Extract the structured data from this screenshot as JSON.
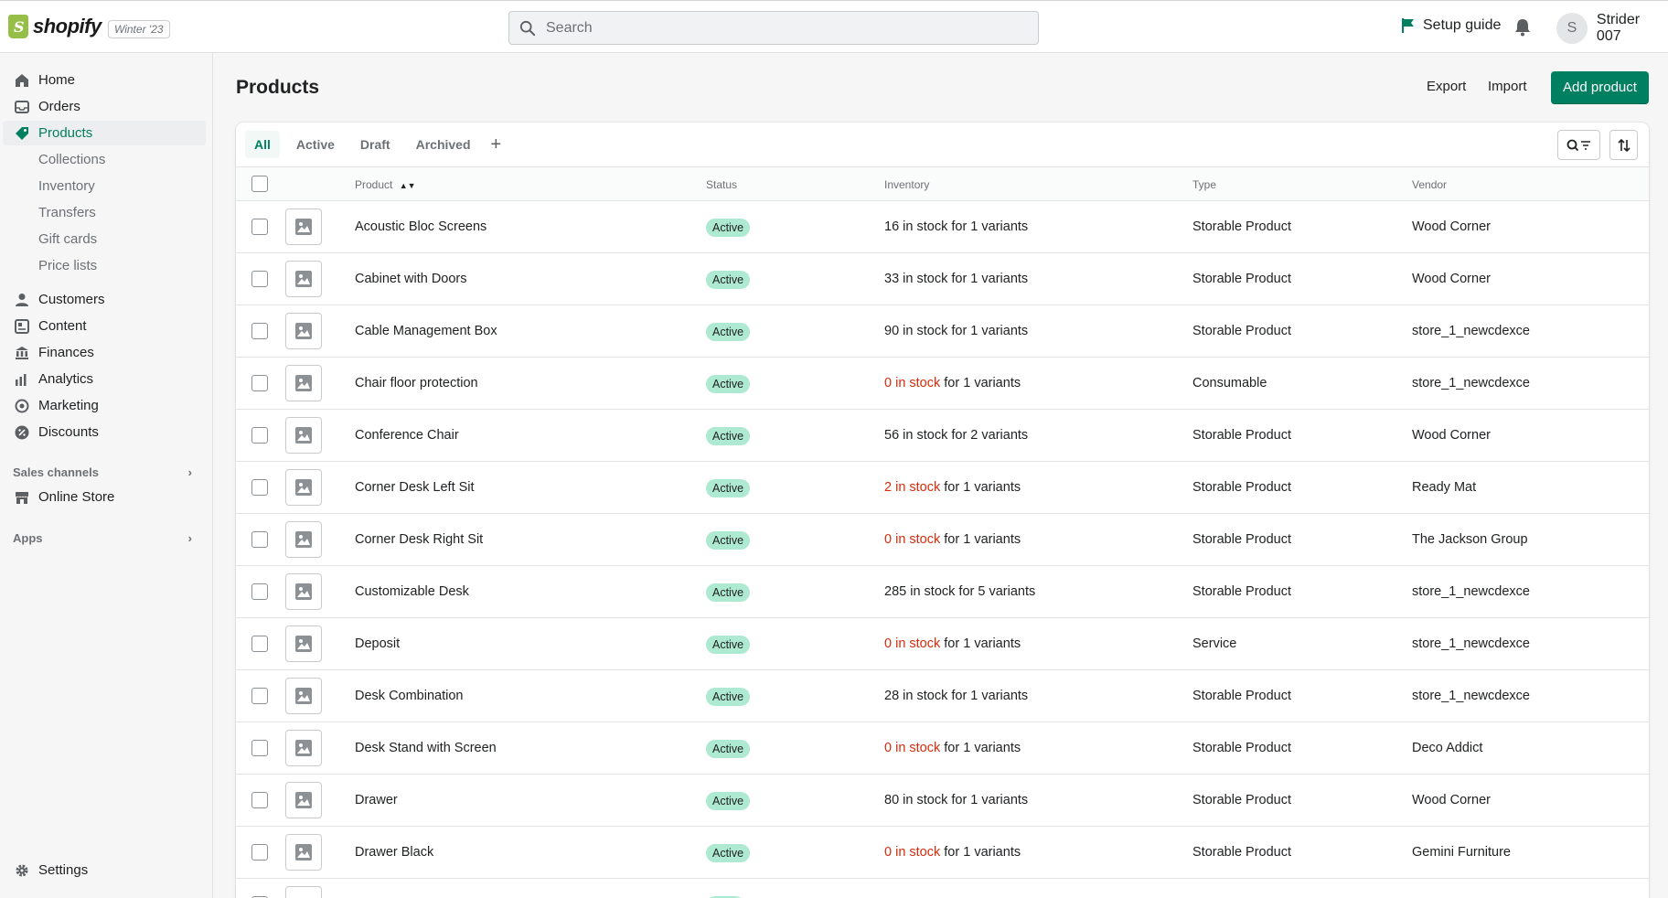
{
  "topbar": {
    "brand": "shopify",
    "version": "Winter '23",
    "search_placeholder": "Search",
    "setup_guide": "Setup guide",
    "user_initial": "S",
    "user_name": "Strider 007"
  },
  "sidebar": {
    "main_items": [
      "Home",
      "Orders",
      "Products"
    ],
    "product_sub_items": [
      "Collections",
      "Inventory",
      "Transfers",
      "Gift cards",
      "Price lists"
    ],
    "other_items": [
      "Customers",
      "Content",
      "Finances",
      "Analytics",
      "Marketing",
      "Discounts"
    ],
    "sales_channels_title": "Sales channels",
    "sales_channels": [
      "Online Store"
    ],
    "apps_title": "Apps",
    "settings": "Settings"
  },
  "page": {
    "title": "Products",
    "export": "Export",
    "import": "Import",
    "add_product": "Add product"
  },
  "tabs": [
    "All",
    "Active",
    "Draft",
    "Archived"
  ],
  "table": {
    "columns": [
      "Product",
      "Status",
      "Inventory",
      "Type",
      "Vendor"
    ],
    "rows": [
      {
        "name": "Acoustic Bloc Screens",
        "status": "Active",
        "stock": "16 in stock",
        "variants": " for 1 variants",
        "low": false,
        "type": "Storable Product",
        "vendor": "Wood Corner"
      },
      {
        "name": "Cabinet with Doors",
        "status": "Active",
        "stock": "33 in stock",
        "variants": " for 1 variants",
        "low": false,
        "type": "Storable Product",
        "vendor": "Wood Corner"
      },
      {
        "name": "Cable Management Box",
        "status": "Active",
        "stock": "90 in stock",
        "variants": " for 1 variants",
        "low": false,
        "type": "Storable Product",
        "vendor": "store_1_newcdexce"
      },
      {
        "name": "Chair floor protection",
        "status": "Active",
        "stock": "0 in stock",
        "variants": " for 1 variants",
        "low": true,
        "type": "Consumable",
        "vendor": "store_1_newcdexce"
      },
      {
        "name": "Conference Chair",
        "status": "Active",
        "stock": "56 in stock",
        "variants": " for 2 variants",
        "low": false,
        "type": "Storable Product",
        "vendor": "Wood Corner"
      },
      {
        "name": "Corner Desk Left Sit",
        "status": "Active",
        "stock": "2 in stock",
        "variants": " for 1 variants",
        "low": true,
        "type": "Storable Product",
        "vendor": "Ready Mat"
      },
      {
        "name": "Corner Desk Right Sit",
        "status": "Active",
        "stock": "0 in stock",
        "variants": " for 1 variants",
        "low": true,
        "type": "Storable Product",
        "vendor": "The Jackson Group"
      },
      {
        "name": "Customizable Desk",
        "status": "Active",
        "stock": "285 in stock",
        "variants": " for 5 variants",
        "low": false,
        "type": "Storable Product",
        "vendor": "store_1_newcdexce"
      },
      {
        "name": "Deposit",
        "status": "Active",
        "stock": "0 in stock",
        "variants": " for 1 variants",
        "low": true,
        "type": "Service",
        "vendor": "store_1_newcdexce"
      },
      {
        "name": "Desk Combination",
        "status": "Active",
        "stock": "28 in stock",
        "variants": " for 1 variants",
        "low": false,
        "type": "Storable Product",
        "vendor": "store_1_newcdexce"
      },
      {
        "name": "Desk Stand with Screen",
        "status": "Active",
        "stock": "0 in stock",
        "variants": " for 1 variants",
        "low": true,
        "type": "Storable Product",
        "vendor": "Deco Addict"
      },
      {
        "name": "Drawer",
        "status": "Active",
        "stock": "80 in stock",
        "variants": " for 1 variants",
        "low": false,
        "type": "Storable Product",
        "vendor": "Wood Corner"
      },
      {
        "name": "Drawer Black",
        "status": "Active",
        "stock": "0 in stock",
        "variants": " for 1 variants",
        "low": true,
        "type": "Storable Product",
        "vendor": "Gemini Furniture"
      }
    ]
  },
  "colors": {
    "accent": "#008060",
    "badge": "#aee9d1",
    "low_stock": "#d72c0d"
  }
}
